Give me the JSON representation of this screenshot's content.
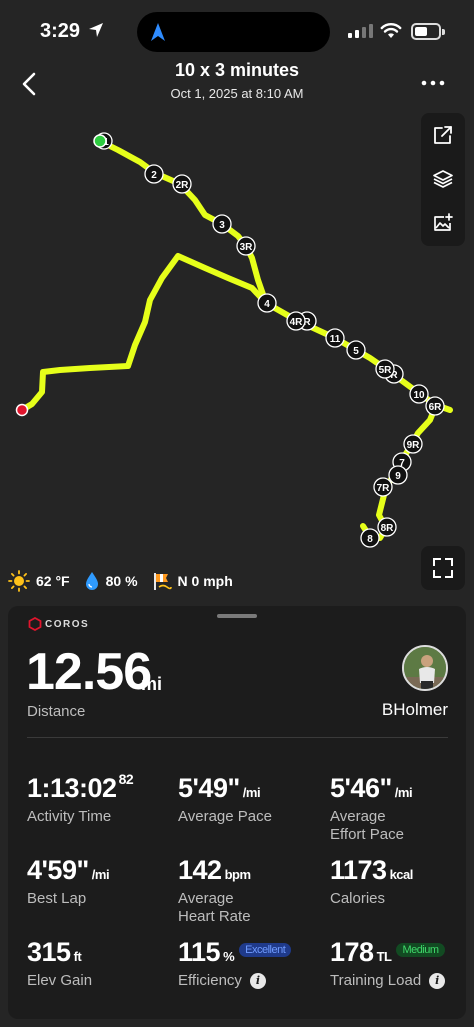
{
  "status_bar": {
    "time": "3:29"
  },
  "header": {
    "title": "10 x 3 minutes",
    "subtitle": "Oct 1, 2025 at 8:10 AM"
  },
  "map": {
    "route_color": "#e6ff1a",
    "start_color": "#2ecc40",
    "end_color": "#e0152d",
    "lap_markers": [
      "1",
      "2",
      "2R",
      "3",
      "3R",
      "4",
      "4R",
      "R",
      "11",
      "5",
      "5R",
      "R",
      "10",
      "6R",
      "9R",
      "7",
      "9",
      "7R",
      "8R",
      "8"
    ]
  },
  "weather": {
    "temperature": "62 °F",
    "humidity": "80 %",
    "wind": "N 0 mph"
  },
  "card": {
    "brand": "COROS",
    "distance": {
      "value": "12.56",
      "unit": "mi",
      "label": "Distance"
    },
    "username": "BHolmer",
    "stats": {
      "activity_time": {
        "value": "1:13:02",
        "sup": "82",
        "label": "Activity Time"
      },
      "average_pace": {
        "value": "5'49\"",
        "unit": "/mi",
        "label": "Average Pace"
      },
      "effort_pace": {
        "value": "5'46\"",
        "unit": "/mi",
        "label1": "Average",
        "label2": "Effort Pace"
      },
      "best_lap": {
        "value": "4'59\"",
        "unit": "/mi",
        "label": "Best Lap"
      },
      "heart_rate": {
        "value": "142",
        "unit": "bpm",
        "label1": "Average",
        "label2": "Heart Rate"
      },
      "calories": {
        "value": "1173",
        "unit": "kcal",
        "label": "Calories"
      },
      "elev_gain": {
        "value": "315",
        "unit": "ft",
        "label": "Elev Gain"
      },
      "efficiency": {
        "value": "115",
        "unit": "%",
        "badge": "Excellent",
        "label": "Efficiency"
      },
      "training_load": {
        "value": "178",
        "unit": "TL",
        "badge": "Medium",
        "label": "Training Load"
      }
    }
  }
}
